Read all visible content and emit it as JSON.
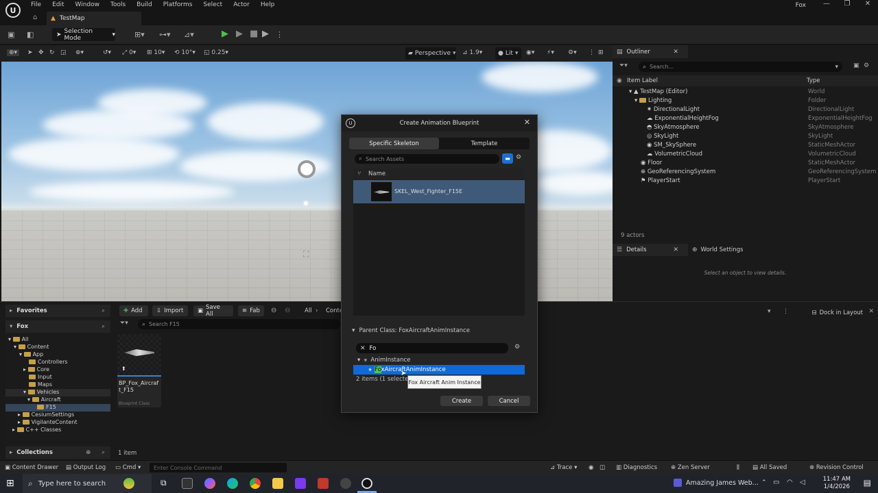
{
  "app": {
    "menus": [
      "File",
      "Edit",
      "Window",
      "Tools",
      "Build",
      "Platforms",
      "Select",
      "Actor",
      "Help"
    ],
    "window_title": "Fox",
    "level_tab": "TestMap"
  },
  "toolbar": {
    "selection_mode": "Selection Mode"
  },
  "viewport_toolbar": {
    "snap_rotation": "0",
    "grid_size": "10",
    "rotation_snap": "10°",
    "scale_snap": "0.25",
    "perspective": "Perspective",
    "camera_speed": "1.9",
    "lit": "Lit"
  },
  "outliner": {
    "tab": "Outliner",
    "search_placeholder": "Search...",
    "col_label": "Item Label",
    "col_type": "Type",
    "rows": [
      {
        "label": "TestMap (Editor)",
        "type": "World"
      },
      {
        "label": "Lighting",
        "type": "Folder"
      },
      {
        "label": "DirectionalLight",
        "type": "DirectionalLight"
      },
      {
        "label": "ExponentialHeightFog",
        "type": "ExponentialHeightFog"
      },
      {
        "label": "SkyAtmosphere",
        "type": "SkyAtmosphere"
      },
      {
        "label": "SkyLight",
        "type": "SkyLight"
      },
      {
        "label": "SM_SkySphere",
        "type": "StaticMeshActor"
      },
      {
        "label": "VolumetricCloud",
        "type": "VolumetricCloud"
      },
      {
        "label": "Floor",
        "type": "StaticMeshActor"
      },
      {
        "label": "GeoReferencingSystem",
        "type": "GeoReferencingSystem"
      },
      {
        "label": "PlayerStart",
        "type": "PlayerStart"
      }
    ],
    "actor_count": "9 actors"
  },
  "details": {
    "tab": "Details",
    "world_settings_tab": "World Settings",
    "empty_text": "Select an object to view details."
  },
  "content_browser": {
    "favorites": "Favorites",
    "project": "Fox",
    "tree": [
      {
        "label": "All"
      },
      {
        "label": "Content"
      },
      {
        "label": "App"
      },
      {
        "label": "Controllers"
      },
      {
        "label": "Core"
      },
      {
        "label": "Input"
      },
      {
        "label": "Maps"
      },
      {
        "label": "Vehicles"
      },
      {
        "label": "Aircraft"
      },
      {
        "label": "F15"
      },
      {
        "label": "CesiumSettings"
      },
      {
        "label": "VigilanteContent"
      },
      {
        "label": "C++ Classes"
      }
    ],
    "collections": "Collections",
    "add": "Add",
    "import": "Import",
    "save_all": "Save All",
    "fab": "Fab",
    "path_all": "All",
    "path_content": "Conte",
    "search_placeholder": "Search F15",
    "asset_name": "BP_Fox_Aircraft_F15",
    "asset_type": "Blueprint Class",
    "item_count": "1 item",
    "dock_layout": "Dock in Layout"
  },
  "dialog": {
    "title": "Create Animation Blueprint",
    "tab_skeleton": "Specific Skeleton",
    "tab_template": "Template",
    "search_placeholder": "Search Assets",
    "col_name": "Name",
    "skeleton_name": "SKEL_West_Fighter_F15E",
    "parent_class": "Parent Class: FoxAircraftAnimInstance",
    "filter_value": "Fo",
    "tree_root": "AnimInstance",
    "selected_class_match": "Fo",
    "selected_class_rest": "xAircraftAnimInstance",
    "status": "2 items (1 selected)",
    "tooltip": "Fox Aircraft Anim Instance",
    "create": "Create",
    "cancel": "Cancel"
  },
  "statusbar": {
    "content_drawer": "Content Drawer",
    "output_log": "Output Log",
    "cmd": "Cmd",
    "console_placeholder": "Enter Console Command",
    "trace": "Trace",
    "diagnostics": "Diagnostics",
    "zen_server": "Zen Server",
    "all_saved": "All Saved",
    "revision_control": "Revision Control"
  },
  "taskbar": {
    "search": "Type here to search",
    "notification": "Amazing James Web...",
    "time": "11:47 AM",
    "date": "1/4/2026"
  }
}
